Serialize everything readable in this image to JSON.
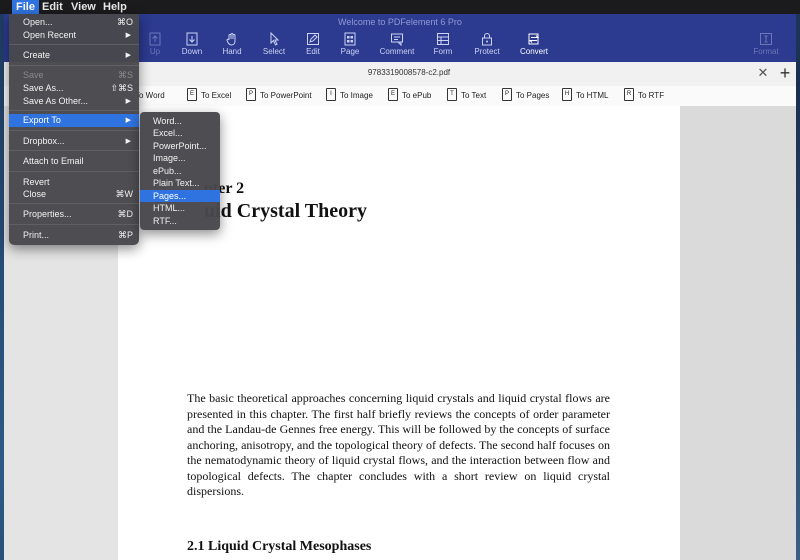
{
  "menubar": {
    "apple": "",
    "items": [
      "File",
      "Edit",
      "View",
      "Help"
    ]
  },
  "window": {
    "title": "Welcome to PDFelement 6 Pro"
  },
  "toolbar": {
    "buttons": [
      {
        "label": "Up",
        "icon": "arrow-up-icon",
        "state": "dim"
      },
      {
        "label": "Down",
        "icon": "arrow-down-icon",
        "state": "normal"
      },
      {
        "label": "Hand",
        "icon": "hand-icon",
        "state": "normal"
      },
      {
        "label": "Select",
        "icon": "cursor-icon",
        "state": "normal"
      },
      {
        "label": "Edit",
        "icon": "edit-icon",
        "state": "normal"
      },
      {
        "label": "Page",
        "icon": "page-icon",
        "state": "normal"
      },
      {
        "label": "Comment",
        "icon": "comment-icon",
        "state": "normal"
      },
      {
        "label": "Form",
        "icon": "form-icon",
        "state": "normal"
      },
      {
        "label": "Protect",
        "icon": "lock-icon",
        "state": "normal"
      },
      {
        "label": "Convert",
        "icon": "convert-icon",
        "state": "active"
      },
      {
        "label": "Format",
        "icon": "format-icon",
        "state": "dim"
      }
    ]
  },
  "tab": {
    "title": "9783319008578-c2.pdf",
    "close_icon": "close-icon",
    "add_icon": "plus-icon"
  },
  "convert_bar": [
    {
      "label": "To Word",
      "glyph": "W"
    },
    {
      "label": "To Excel",
      "glyph": "E"
    },
    {
      "label": "To PowerPoint",
      "glyph": "P"
    },
    {
      "label": "To Image",
      "glyph": "I"
    },
    {
      "label": "To ePub",
      "glyph": "E"
    },
    {
      "label": "To Text",
      "glyph": "T"
    },
    {
      "label": "To Pages",
      "glyph": "P"
    },
    {
      "label": "To HTML",
      "glyph": "H"
    },
    {
      "label": "To RTF",
      "glyph": "R"
    }
  ],
  "document": {
    "chapter_number": "pter 2",
    "chapter_title": "uid Crystal Theory",
    "body": "The basic theoretical approaches concerning liquid crystals and liquid crystal flows are presented in this chapter. The first half briefly reviews the concepts of order parameter and the Landau-de Gennes free energy. This will be followed by the concepts of surface anchoring, anisotropy, and the topological theory of defects. The second half focuses on the nematodynamic theory of liquid crystal flows, and the interaction between flow and topological defects. The chapter concludes with a short review on liquid crystal dispersions.",
    "section_heading": "2.1  Liquid Crystal Mesophases"
  },
  "file_menu": {
    "items": [
      {
        "label": "Open...",
        "shortcut": "⌘O"
      },
      {
        "label": "Open Recent",
        "submenu": true
      },
      {
        "separator": true
      },
      {
        "label": "Create",
        "submenu": true
      },
      {
        "separator": true
      },
      {
        "label": "Save",
        "shortcut": "⌘S",
        "disabled": true
      },
      {
        "label": "Save As...",
        "shortcut": "⇧⌘S"
      },
      {
        "label": "Save As Other...",
        "submenu": true
      },
      {
        "separator": true
      },
      {
        "label": "Export To",
        "submenu": true,
        "highlighted": true
      },
      {
        "separator": true
      },
      {
        "label": "Dropbox...",
        "submenu": true
      },
      {
        "separator": true
      },
      {
        "label": "Attach to Email"
      },
      {
        "separator": true
      },
      {
        "label": "Revert"
      },
      {
        "label": "Close",
        "shortcut": "⌘W"
      },
      {
        "separator": true
      },
      {
        "label": "Properties...",
        "shortcut": "⌘D"
      },
      {
        "separator": true
      },
      {
        "label": "Print...",
        "shortcut": "⌘P"
      }
    ]
  },
  "export_submenu": {
    "items": [
      {
        "label": "Word..."
      },
      {
        "label": "Excel..."
      },
      {
        "label": "PowerPoint..."
      },
      {
        "label": "Image..."
      },
      {
        "label": "ePub..."
      },
      {
        "label": "Plain Text..."
      },
      {
        "label": "Pages...",
        "highlighted": true
      },
      {
        "label": "HTML..."
      },
      {
        "label": "RTF..."
      }
    ]
  },
  "colors": {
    "toolbar_bg": "#2c3a8f",
    "menu_highlight": "#2f73e0",
    "menu_bg": "#48484c"
  }
}
